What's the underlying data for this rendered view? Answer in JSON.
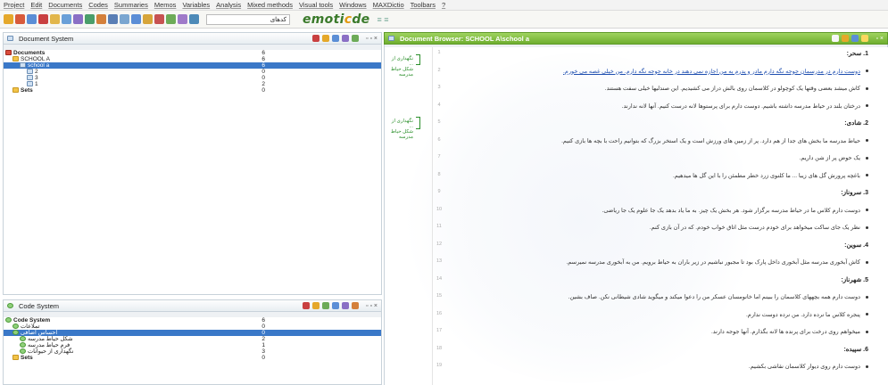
{
  "menu": [
    "Project",
    "Edit",
    "Documents",
    "Codes",
    "Summaries",
    "Memos",
    "Variables",
    "Analysis",
    "Mixed methods",
    "Visual tools",
    "Windows",
    "MAXDictio",
    "Toolbars",
    "?"
  ],
  "toolbar": {
    "selector_value": "کدهای",
    "logo_left": "emoti",
    "logo_accent": "c",
    "logo_right": "de"
  },
  "document_system": {
    "title": "Document System",
    "rows": [
      {
        "label": "Documents",
        "count": "6",
        "icon": "documents-icon"
      },
      {
        "label": "SCHOOL A",
        "count": "6",
        "icon": "folder-icon"
      },
      {
        "label": "school a",
        "count": "6",
        "icon": "doc-icon",
        "selected": true
      },
      {
        "label": "2",
        "count": "0",
        "icon": "doc-icon"
      },
      {
        "label": "3",
        "count": "0",
        "icon": "doc-icon"
      },
      {
        "label": "1",
        "count": "2",
        "icon": "doc-icon"
      },
      {
        "label": "Sets",
        "count": "0",
        "icon": "sets-icon"
      }
    ]
  },
  "code_system": {
    "title": "Code System",
    "rows": [
      {
        "label": "Code System",
        "count": "6",
        "icon": "code-icon"
      },
      {
        "label": "تملاعات",
        "count": "0",
        "icon": "code-icon"
      },
      {
        "label": "احساس اضافی",
        "count": "0",
        "icon": "code-icon",
        "selected": true
      },
      {
        "label": "شکل حیاط مدرسه",
        "count": "2",
        "icon": "code-icon"
      },
      {
        "label": "فرم حیاط مدرسه",
        "count": "1",
        "icon": "code-icon"
      },
      {
        "label": "نگهداری از حیوانات",
        "count": "3",
        "icon": "code-icon"
      },
      {
        "label": "Sets",
        "count": "0",
        "icon": "sets-icon"
      }
    ]
  },
  "document_browser": {
    "title": "Document Browser: SCHOOL A\\school a",
    "code_labels": [
      {
        "text": "نگهداری از ...\nشکل حیاط مدرسه"
      },
      {
        "text": "نگهداری از ...\nشکل حیاط مدرسه"
      }
    ],
    "lines": [
      {
        "num": "1",
        "text": "1. سحر:",
        "heading": true
      },
      {
        "num": "2",
        "text": "دوست دارم در مدرسمان جوجه نگه دارم مادر و پدرم به من اجازه نمی دهند در خانه جوجه نگه دارم. من خیلی غصه می خورم.",
        "bullet": true,
        "highlight": true
      },
      {
        "num": "3",
        "text": "کاش میشد بعضی وقتها یک کوچولو در کلاسمان روی بالش دراز می کشیدیم. این صندلیها خیلی سفت هستند.",
        "bullet": true
      },
      {
        "num": "4",
        "text": "درختان بلند در حیاط مدرسه داشته باشیم. دوست دارم برای پرستوها لانه درست کنیم. آنها لانه ندارند.",
        "bullet": true
      },
      {
        "num": "5",
        "text": "2. شادی:",
        "heading": true
      },
      {
        "num": "6",
        "text": "حیاط مدرسه ما بخش های جدا از هم دارد. پر از زمین های ورزش است و یک استخر بزرگ که بتوانیم راحت با بچه ها بازی کنیم.",
        "bullet": true
      },
      {
        "num": "7",
        "text": "یک حوض پر از شن داریم.",
        "bullet": true
      },
      {
        "num": "8",
        "text": "باغچه پرورش گل های زیبا ... ما کلنوی زرد خطر مطمئن را با این گل ها میدهیم.",
        "bullet": true
      },
      {
        "num": "9",
        "text": "3. سروناز:",
        "heading": true
      },
      {
        "num": "10",
        "text": "دوست دارم کلاس ما در حیاط مدرسه برگزار شود. هر بخش یک چیز. به ما یاد بدهد یک جا علوم یک جا ریاضی.",
        "bullet": true
      },
      {
        "num": "11",
        "text": "نظر یک جای ساکت میخواهد برای خودم درست مثل اتاق خواب خودم. که در آن بازی کنم.",
        "bullet": true
      },
      {
        "num": "12",
        "text": "4. سوین:",
        "heading": true
      },
      {
        "num": "13",
        "text": "کاش آبخوری مدرسه مثل آبخوری داخل پارک بود تا مجبور نباشیم در زیر باران به حیاط برویم. من به آبخوری مدرسه نمیرسم.",
        "bullet": true
      },
      {
        "num": "14",
        "text": "5. شهرناز:",
        "heading": true
      },
      {
        "num": "15",
        "text": "دوست دارم همه بچههای کلاسمان را ببینم اما خانومسان عسکر من را دعوا میکند و میگوید شادی شیطانی نکن. صاف بشین.",
        "bullet": true
      },
      {
        "num": "16",
        "text": "پنجره کلاس ما نرده دارد. من نرده دوست ندارم.",
        "bullet": true
      },
      {
        "num": "17",
        "text": "میخواهم روی درخت برای پرنده ها لانه بگذارم. آنها جوجه دارند.",
        "bullet": true
      },
      {
        "num": "18",
        "text": "6. سپیده:",
        "heading": true
      },
      {
        "num": "19",
        "text": "دوست دارم روی دیوار کلاسمان نقاشی بکشیم.",
        "bullet": true
      }
    ]
  }
}
